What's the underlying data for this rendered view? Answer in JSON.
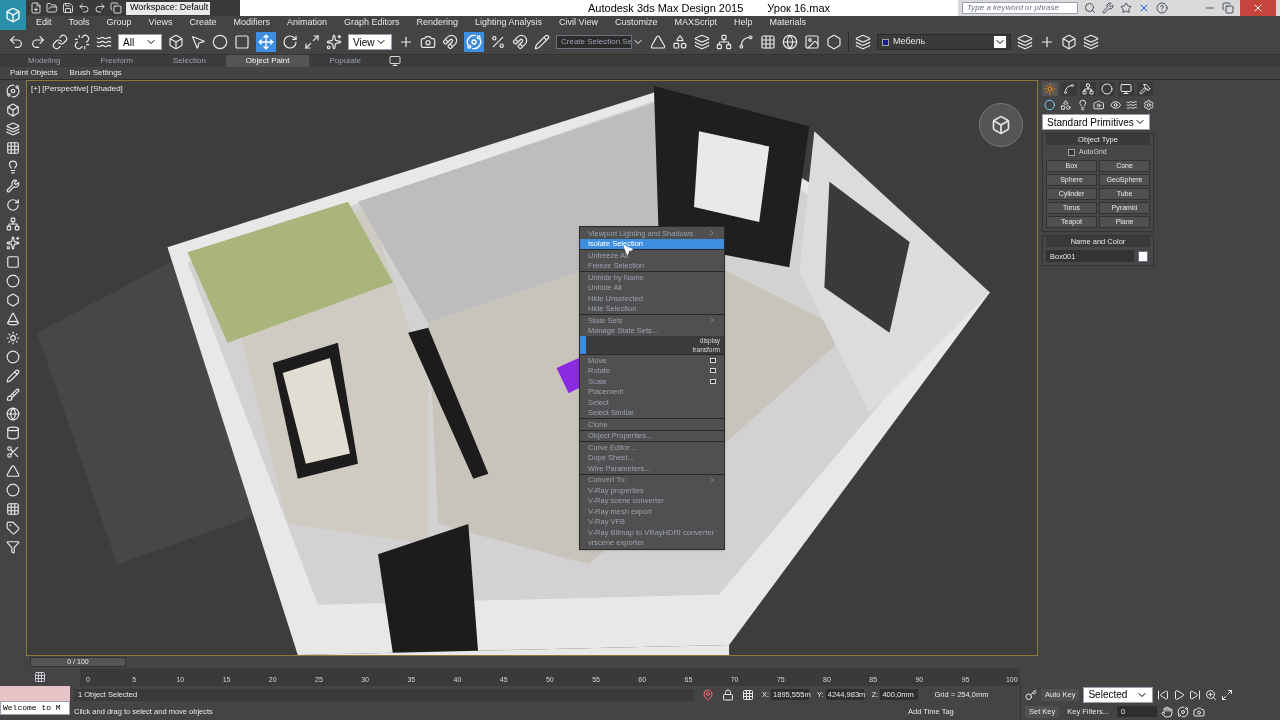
{
  "title_bar": {
    "workspace": "Workspace: Default",
    "app_title": "Autodesk 3ds Max Design 2015",
    "file_name": "Урок 16.max",
    "search_placeholder": "Type a keyword or phrase"
  },
  "menu_bar": [
    "Edit",
    "Tools",
    "Group",
    "Views",
    "Create",
    "Modifiers",
    "Animation",
    "Graph Editors",
    "Rendering",
    "Lighting Analysis",
    "Civil View",
    "Customize",
    "MAXScript",
    "Help",
    "Materials"
  ],
  "main_toolbar": {
    "selection_filter": "All",
    "reference_coord": "View",
    "named_selection": "Create Selection Se",
    "layer": "Мебель"
  },
  "ribbon": {
    "tabs": [
      {
        "label": "Modeling",
        "selected": false
      },
      {
        "label": "Freeform",
        "selected": false
      },
      {
        "label": "Selection",
        "selected": false
      },
      {
        "label": "Object Paint",
        "selected": true
      },
      {
        "label": "Populate",
        "selected": false
      }
    ],
    "panels": [
      "Paint Objects",
      "Brush Settings"
    ]
  },
  "viewport": {
    "label": "[+] [Perspective] [Shaded]",
    "quad_menu": {
      "sections": [
        {
          "items": [
            {
              "kind": "submenu",
              "label": "Viewport Lighting and Shadows",
              "selected": false
            },
            {
              "kind": "command",
              "label": "Isolate Selection",
              "selected": true
            }
          ]
        },
        {
          "items": [
            {
              "kind": "command",
              "label": "Unfreeze All",
              "selected": false
            },
            {
              "kind": "command",
              "label": "Freeze Selection",
              "selected": false
            }
          ]
        },
        {
          "items": [
            {
              "kind": "command",
              "label": "Unhide by Name",
              "selected": false
            },
            {
              "kind": "command",
              "label": "Unhide All",
              "selected": false
            },
            {
              "kind": "command",
              "label": "Hide Unselected",
              "selected": false
            },
            {
              "kind": "command",
              "label": "Hide Selection",
              "selected": false
            }
          ]
        },
        {
          "items": [
            {
              "kind": "submenu",
              "label": "State Sets",
              "selected": false
            },
            {
              "kind": "command",
              "label": "Manage State Sets...",
              "selected": false
            },
            {
              "kind": "header",
              "label": "display",
              "selected": false
            },
            {
              "kind": "header",
              "label": "transform",
              "selected": false
            }
          ]
        },
        {
          "items": [
            {
              "kind": "option",
              "label": "Move",
              "selected": false
            },
            {
              "kind": "option",
              "label": "Rotate",
              "selected": false
            },
            {
              "kind": "option",
              "label": "Scale",
              "selected": false
            },
            {
              "kind": "command",
              "label": "Placement",
              "selected": false
            },
            {
              "kind": "command",
              "label": "Select",
              "selected": false
            },
            {
              "kind": "command",
              "label": "Select Similar",
              "selected": false
            }
          ]
        },
        {
          "items": [
            {
              "kind": "command",
              "label": "Clone",
              "selected": false
            }
          ]
        },
        {
          "items": [
            {
              "kind": "command",
              "label": "Object Properties...",
              "selected": false
            }
          ]
        },
        {
          "items": [
            {
              "kind": "command",
              "label": "Curve Editor...",
              "selected": false
            },
            {
              "kind": "command",
              "label": "Dope Sheet...",
              "selected": false
            },
            {
              "kind": "command",
              "label": "Wire Parameters...",
              "selected": false
            }
          ]
        },
        {
          "items": [
            {
              "kind": "submenu",
              "label": "Convert To:",
              "selected": false
            },
            {
              "kind": "command",
              "label": "V-Ray properties",
              "selected": false
            },
            {
              "kind": "command",
              "label": "V-Ray scene converter",
              "selected": false
            },
            {
              "kind": "command",
              "label": "V-Ray mesh export",
              "selected": false
            },
            {
              "kind": "command",
              "label": "V-Ray VFB",
              "selected": false
            },
            {
              "kind": "command",
              "label": "V-Ray Bitmap to VRayHDRI converter",
              "selected": false
            },
            {
              "kind": "command",
              "label": "vrscene exporter",
              "selected": false
            }
          ]
        }
      ]
    }
  },
  "command_panel": {
    "tabs": [
      {
        "selected": true
      },
      {
        "selected": false
      },
      {
        "selected": false
      },
      {
        "selected": false
      },
      {
        "selected": false
      },
      {
        "selected": false
      }
    ],
    "category": "Standard Primitives",
    "object_type": {
      "title": "Object Type",
      "autogrid": {
        "label": "AutoGrid",
        "checked": false
      },
      "buttons": [
        "Box",
        "Cone",
        "Sphere",
        "GeoSphere",
        "Cylinder",
        "Tube",
        "Torus",
        "Pyramid",
        "Teapot",
        "Plane"
      ]
    },
    "name_and_color": {
      "title": "Name and Color",
      "name": "Box001",
      "color": "#ffffff"
    }
  },
  "time_slider": {
    "frame": "0 / 100",
    "ticks": [
      "0",
      "5",
      "10",
      "15",
      "20",
      "25",
      "30",
      "35",
      "40",
      "45",
      "50",
      "55",
      "60",
      "65",
      "70",
      "75",
      "80",
      "85",
      "90",
      "95",
      "100"
    ]
  },
  "status_bar": {
    "maxscript": "Welcome to M",
    "selection": "1 Object Selected",
    "prompt": "Click and drag to select and move objects",
    "coords": [
      {
        "label": "X:",
        "value": "1895,555m"
      },
      {
        "label": "Y:",
        "value": "4244,983m"
      },
      {
        "label": "Z:",
        "value": "400,0mm"
      }
    ],
    "grid": "Grid = 254,0mm",
    "time_tag": "Add Time Tag",
    "auto_key": "Auto Key",
    "key_mode": "Selected",
    "set_key": "Set Key",
    "key_filters": "Key Filters...",
    "current_frame": "0"
  }
}
